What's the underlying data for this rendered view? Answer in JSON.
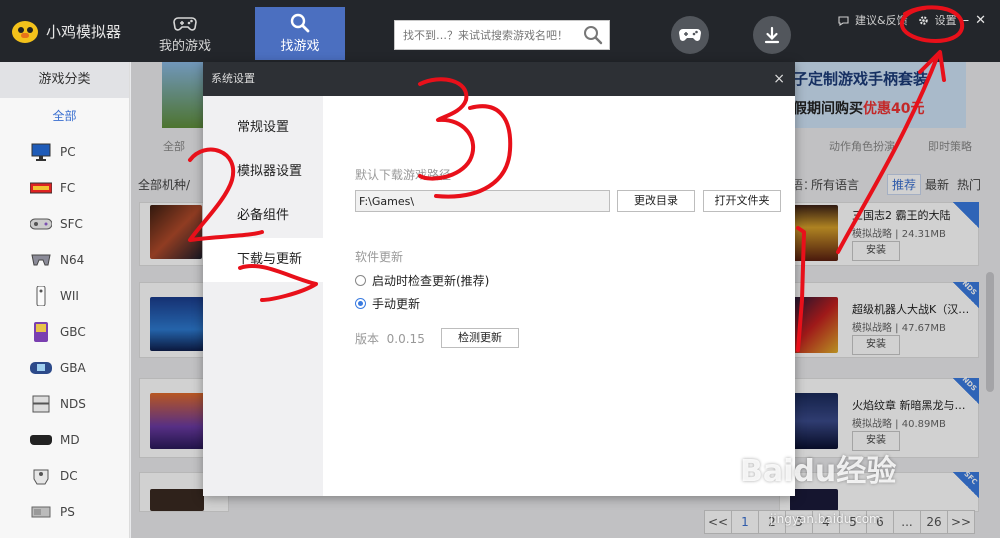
{
  "app": {
    "name": "小鸡模拟器",
    "nav_tabs": [
      {
        "label": "我的游戏",
        "icon": "gamepad-icon"
      },
      {
        "label": "找游戏",
        "icon": "search-icon",
        "active": true
      }
    ],
    "search_placeholder": "找不到…？来试试搜索游戏名吧！",
    "feedback_label": "建议&反馈",
    "settings_label": "设置",
    "minimize": "–",
    "close": "✕",
    "accent_color": "#4b6fc0"
  },
  "sidebar": {
    "header": "游戏分类",
    "all_label": "全部",
    "items": [
      {
        "label": "PC",
        "icon": "monitor-icon"
      },
      {
        "label": "FC",
        "icon": "fc-console-icon"
      },
      {
        "label": "SFC",
        "icon": "sfc-controller-icon"
      },
      {
        "label": "N64",
        "icon": "n64-controller-icon"
      },
      {
        "label": "WII",
        "icon": "wii-remote-icon"
      },
      {
        "label": "GBC",
        "icon": "gbc-handheld-icon"
      },
      {
        "label": "GBA",
        "icon": "gba-handheld-icon"
      },
      {
        "label": "NDS",
        "icon": "nds-handheld-icon"
      },
      {
        "label": "MD",
        "icon": "md-controller-icon"
      },
      {
        "label": "DC",
        "icon": "dc-controller-icon"
      },
      {
        "label": "PS",
        "icon": "ps-console-icon"
      }
    ]
  },
  "main": {
    "banner_line1": "子定制游戏手柄套装",
    "banner_line2_prefix": "假期间购买",
    "banner_line2_highlight": "优惠40元",
    "subnav": {
      "all": "全部",
      "cat1": "动作角色扮演",
      "cat2": "即时策略"
    },
    "section_title": "全部机种/",
    "language_label": "语：",
    "language_value": "所有语言",
    "sort_recommended": "推荐",
    "sort_latest": "最新",
    "sort_hot": "热门",
    "games": [
      {
        "title": "三国志2 霸王的大陆",
        "genre": "模拟战略",
        "size": "24.31MB",
        "install": "安装",
        "tag": ""
      },
      {
        "title": "超级机器人大战K（汉…",
        "genre": "模拟战略",
        "size": "47.67MB",
        "install": "安装",
        "tag": "NDS"
      },
      {
        "title": "火焰纹章 新暗黑龙与…",
        "genre": "模拟战略",
        "size": "40.89MB",
        "install": "安装",
        "tag": "NDS"
      },
      {
        "title": "",
        "genre": "",
        "size": "",
        "install": "",
        "tag": "SFC"
      }
    ],
    "pager": [
      "<<",
      "1",
      "2",
      "3",
      "4",
      "5",
      "6",
      "...",
      "26",
      ">>"
    ],
    "current_page": "1"
  },
  "dialog": {
    "title": "系统设置",
    "close": "×",
    "menu": [
      {
        "label": "常规设置"
      },
      {
        "label": "模拟器设置"
      },
      {
        "label": "必备组件"
      },
      {
        "label": "下载与更新",
        "selected": true
      }
    ],
    "download_path_label": "默认下载游戏路径",
    "download_path_value": "F:\\Games\\",
    "change_dir_button": "更改目录",
    "open_folder_button": "打开文件夹",
    "update_label": "软件更新",
    "update_options": [
      {
        "label": "启动时检查更新(推荐)",
        "checked": false
      },
      {
        "label": "手动更新",
        "checked": true
      }
    ],
    "version_label": "版本",
    "version_value": "0.0.15",
    "check_update_button": "检测更新"
  },
  "watermark": {
    "text": "Baidu经验",
    "url": "jingyan.baidu.com"
  },
  "annotations": {
    "color": "#e8101a",
    "numbers": [
      "1",
      "2",
      "3"
    ]
  }
}
